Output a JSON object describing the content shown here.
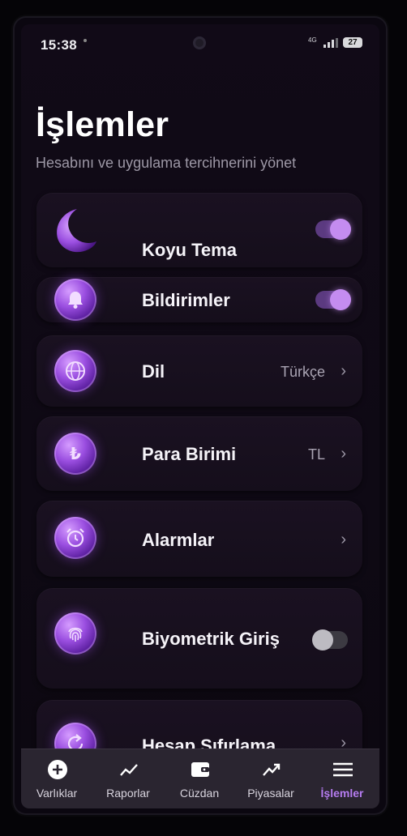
{
  "status_bar": {
    "time": "15:38",
    "network": "4G",
    "battery": "27"
  },
  "header": {
    "title": "İşlemler",
    "subtitle": "Hesabını ve uygulama tercihnerini yönet"
  },
  "settings": [
    {
      "label": "Koyu Tema",
      "icon": "moon-icon",
      "control": "toggle",
      "on": true
    },
    {
      "label": "Bildirimler",
      "icon": "bell-icon",
      "control": "toggle",
      "on": true
    },
    {
      "label": "Dil",
      "icon": "globe-icon",
      "value": "Türkçe",
      "control": "chevron"
    },
    {
      "label": "Para Birimi",
      "icon": "lira-icon",
      "value": "TL",
      "control": "chevron"
    },
    {
      "label": "Alarmlar",
      "icon": "alarm-clock-icon",
      "control": "chevron"
    },
    {
      "label": "Biyometrik Giriş",
      "icon": "fingerprint-icon",
      "control": "toggle",
      "on": false
    },
    {
      "label": "Hesap Sıfırlama",
      "icon": "reset-icon",
      "control": "chevron"
    }
  ],
  "bottom_nav": [
    {
      "label": "Varlıklar",
      "icon": "plus-circle-icon",
      "active": false
    },
    {
      "label": "Raporlar",
      "icon": "trend-line-icon",
      "active": false
    },
    {
      "label": "Cüzdan",
      "icon": "wallet-icon",
      "active": false
    },
    {
      "label": "Piyasalar",
      "icon": "trend-up-icon",
      "active": false
    },
    {
      "label": "İşlemler",
      "icon": "menu-icon",
      "active": true
    }
  ],
  "colors": {
    "accent": "#b57cf0",
    "background": "#0e0914",
    "card": "#1a1121"
  }
}
